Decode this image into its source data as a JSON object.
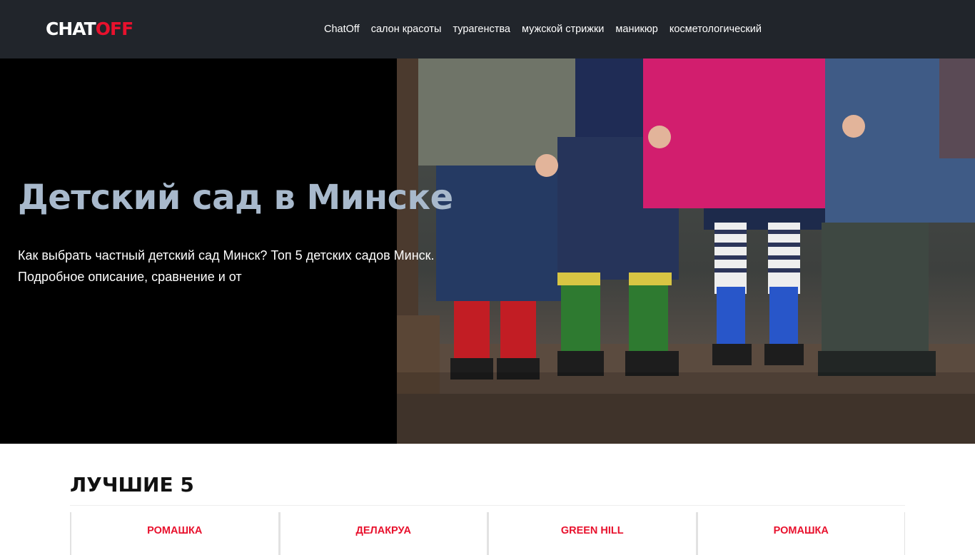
{
  "header": {
    "logo_part1": "CHAT",
    "logo_part2": "OFF",
    "nav": [
      {
        "label": "ChatOff"
      },
      {
        "label": "салон красоты"
      },
      {
        "label": "турагенства"
      },
      {
        "label": "мужской стрижки"
      },
      {
        "label": "маникюр"
      },
      {
        "label": "косметологический"
      }
    ]
  },
  "hero": {
    "title": "Детский сад в Минске",
    "description": "Как выбрать частный детский сад Минск? Топ 5 детских садов Минск. Подробное описание, сравнение и от",
    "image": "children-rain-boots-photo"
  },
  "best": {
    "heading": "ЛУЧШИЕ 5",
    "cards": [
      {
        "name": "РОМАШКА"
      },
      {
        "name": "ДЕЛАКРУА"
      },
      {
        "name": "GREEN HILL"
      },
      {
        "name": "РОМАШКА"
      }
    ]
  },
  "colors": {
    "header_bg": "#21252b",
    "accent": "#e8112d",
    "hero_title": "#a8b9cc"
  }
}
